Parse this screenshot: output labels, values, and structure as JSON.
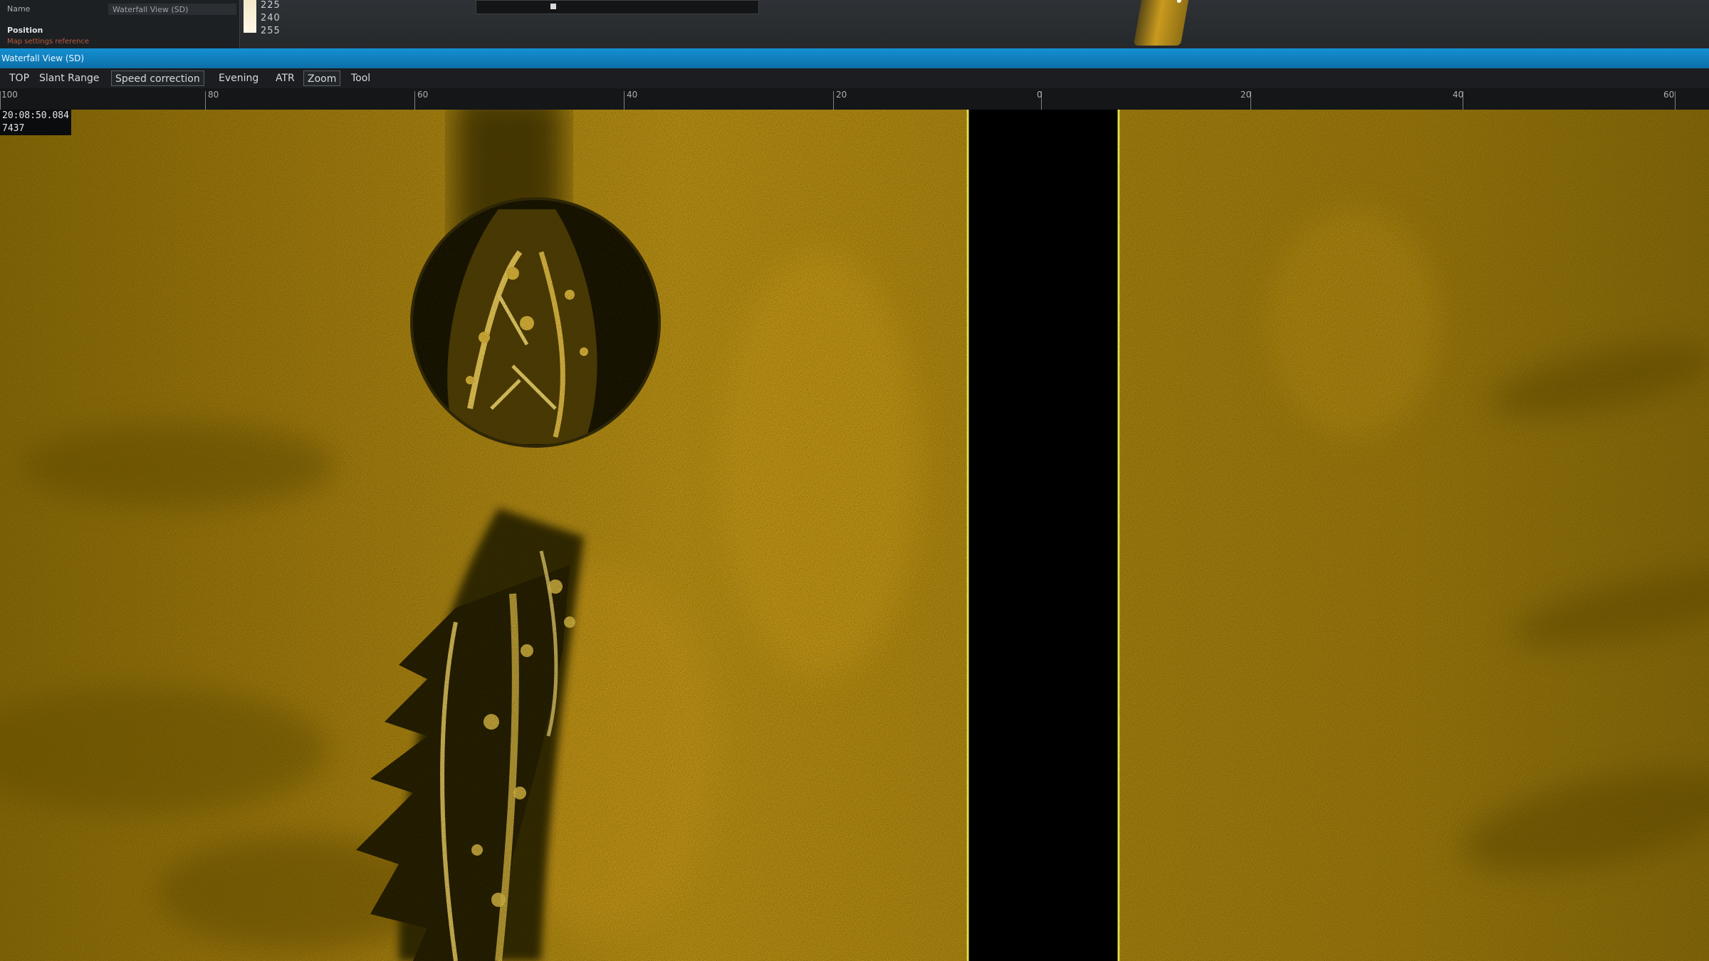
{
  "properties": {
    "name_label": "Name",
    "name_value": "Waterfall View (SD)",
    "section_label": "Position",
    "link_text": "Map settings reference"
  },
  "scale_values": [
    "225",
    "240",
    "255"
  ],
  "window": {
    "title": "Waterfall View (SD)"
  },
  "toolbar": {
    "items": [
      "TOP",
      "Slant Range",
      "Speed correction",
      "Evening",
      "ATR",
      "Zoom",
      "Tool"
    ]
  },
  "ruler": {
    "labels": [
      "100",
      "80",
      "60",
      "40",
      "20",
      "0",
      "20",
      "40",
      "60"
    ]
  },
  "readout": {
    "time": "20:08:50.084",
    "ping": "7437"
  },
  "colors": {
    "accent_title": "#1590d3",
    "seabed": "#b58a12",
    "nadir": "#000000",
    "trace_line": "#e1e04a"
  },
  "icons": {
    "magnifier": "magnifier-lens-icon"
  }
}
